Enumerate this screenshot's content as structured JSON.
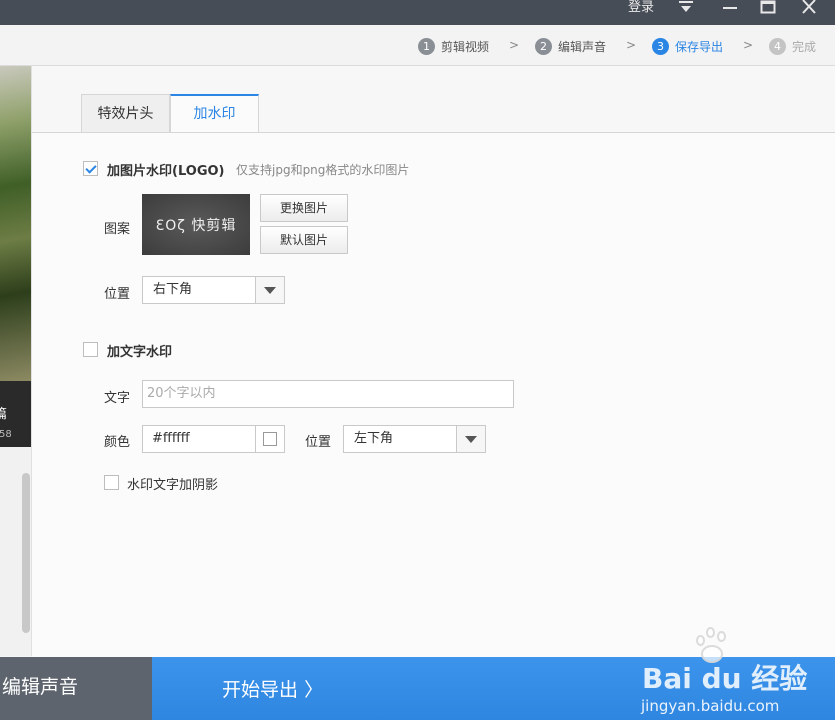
{
  "titlebar": {
    "login": "登录",
    "menu_icon": "menu-down-icon",
    "minimize_icon": "minimize-icon",
    "maximize_icon": "maximize-icon",
    "close_icon": "close-icon"
  },
  "steps": [
    {
      "num": "1",
      "label": "剪辑视频",
      "state": "done"
    },
    {
      "num": "2",
      "label": "编辑声音",
      "state": "done"
    },
    {
      "num": "3",
      "label": "保存导出",
      "state": "active"
    },
    {
      "num": "4",
      "label": "完成",
      "state": "disabled"
    }
  ],
  "steps_separator": ">",
  "preview": {
    "clip_name": "篇",
    "duration": "58"
  },
  "tabs": [
    {
      "label": "特效片头",
      "active": false
    },
    {
      "label": "加水印",
      "active": true
    }
  ],
  "image_watermark": {
    "checked": true,
    "title": "加图片水印(LOGO)",
    "hint": "仅支持jpg和png格式的水印图片",
    "pattern_label": "图案",
    "logo_text": "ƐOζ 快剪辑",
    "change_btn": "更换图片",
    "default_btn": "默认图片",
    "position_label": "位置",
    "position_value": "右下角"
  },
  "text_watermark": {
    "checked": false,
    "title": "加文字水印",
    "text_label": "文字",
    "text_placeholder": "20个字以内",
    "color_label": "颜色",
    "color_value": "#ffffff",
    "position_label": "位置",
    "position_value": "左下角",
    "shadow_checked": false,
    "shadow_label": "水印文字加阴影"
  },
  "bottom": {
    "back_label": "编辑声音",
    "export_label": "开始导出",
    "export_arrow": "〉"
  },
  "watermark_overlay": {
    "logo": "Bai du 经验",
    "url": "jingyan.baidu.com"
  },
  "colors": {
    "accent": "#2b85e4",
    "titlebar": "#474d57",
    "bottom_left": "#5d646e",
    "bottom_right": "#3c94ec"
  }
}
